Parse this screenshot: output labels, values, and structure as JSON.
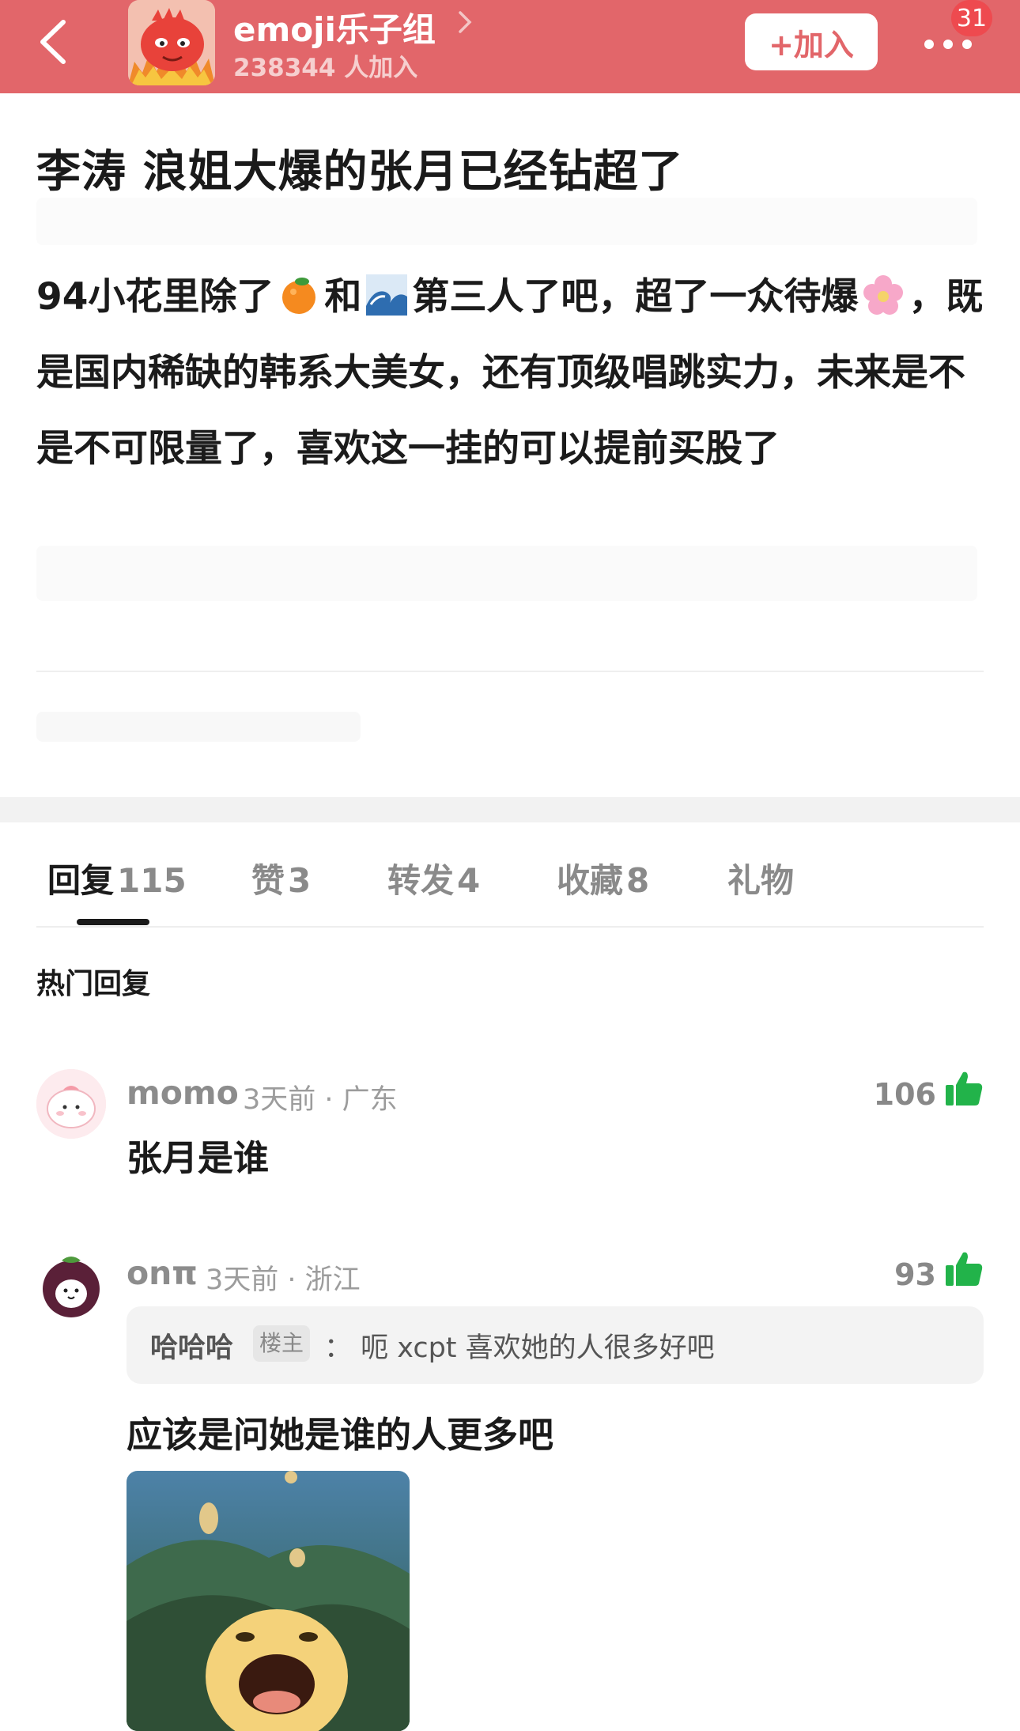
{
  "header": {
    "group_name": "emoji乐子组",
    "member_count": "238344 人加入",
    "join_label": "+加入",
    "notification_count": "31"
  },
  "post": {
    "title": "李涛 浪姐大爆的张月已经钻超了",
    "body_part1": "94小花里除了",
    "body_part2": "和",
    "body_part3": "第三人了吧，超了一众待爆",
    "body_part4": "，既是国内稀缺的韩系大美女，还有顶级唱跳实力，未来是不是不可限量了，喜欢这一挂的可以提前买股了"
  },
  "tabs": [
    {
      "label": "回复",
      "count": "115"
    },
    {
      "label": "赞",
      "count": "3"
    },
    {
      "label": "转发",
      "count": "4"
    },
    {
      "label": "收藏",
      "count": "8"
    },
    {
      "label": "礼物",
      "count": ""
    }
  ],
  "section_title": "热门回复",
  "comments": [
    {
      "user": "momo",
      "meta": "3天前 · 广东",
      "likes": "106",
      "text": "张月是谁"
    },
    {
      "user": "onπ",
      "meta": "3天前 · 浙江",
      "likes": "93",
      "quote_author": "哈哈哈",
      "quote_badge": "楼主",
      "quote_text": "： 呃 xcpt 喜欢她的人很多好吧",
      "text": "应该是问她是谁的人更多吧"
    }
  ],
  "colors": {
    "header_bg": "#e2666a",
    "like_green": "#22b34a",
    "badge_red": "#ee4a4f"
  },
  "icons": [
    "back-arrow-icon",
    "chevron-right-icon",
    "more-dots-icon",
    "orange-emoji-icon",
    "wave-emoji-icon",
    "blossom-emoji-icon",
    "thumbs-up-icon"
  ]
}
